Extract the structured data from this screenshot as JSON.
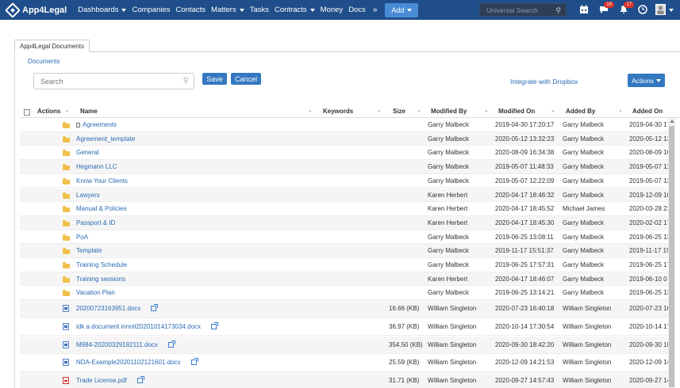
{
  "nav": {
    "brand": "App4Legal",
    "menu": [
      {
        "label": "Dashboards",
        "dropdown": true
      },
      {
        "label": "Companies",
        "dropdown": false
      },
      {
        "label": "Contacts",
        "dropdown": false
      },
      {
        "label": "Matters",
        "dropdown": true
      },
      {
        "label": "Tasks",
        "dropdown": false
      },
      {
        "label": "Contracts",
        "dropdown": true
      },
      {
        "label": "Money",
        "dropdown": false
      },
      {
        "label": "Docs",
        "dropdown": false
      }
    ],
    "more_icon": "double-chevron-down-icon",
    "add_label": "Add",
    "search_placeholder": "Universal Search",
    "messages_badge": "19",
    "notifications_badge": "17"
  },
  "tab": {
    "label": "App4Legal Documents"
  },
  "breadcrumb": "Documents",
  "search": {
    "placeholder": "Search"
  },
  "buttons": {
    "save": "Save",
    "cancel": "Cancel",
    "actions": "Actions"
  },
  "dropbox_link": "Integrate with Dropbox",
  "columns": {
    "actions": "Actions",
    "name": "Name",
    "keywords": "Keywords",
    "size": "Size",
    "modified_by": "Modified By",
    "modified_on": "Modified On",
    "added_by": "Added By",
    "added_on": "Added On"
  },
  "rows": [
    {
      "type": "folder",
      "name": "Agreements",
      "locked": true,
      "size": "",
      "modified_by": "Garry Malbeck",
      "modified_on": "2019-04-30 17:20:17",
      "added_by": "Garry Malbeck",
      "added_on": "2019-04-30 17"
    },
    {
      "type": "folder",
      "name": "Agreement_template",
      "locked": false,
      "size": "",
      "modified_by": "Garry Malbeck",
      "modified_on": "2020-05-12 13:32:23",
      "added_by": "Garry Malbeck",
      "added_on": "2020-05-12 13"
    },
    {
      "type": "folder",
      "name": "General",
      "locked": false,
      "size": "",
      "modified_by": "Garry Malbeck",
      "modified_on": "2020-08-09 16:34:38",
      "added_by": "Garry Malbeck",
      "added_on": "2020-08-09 16"
    },
    {
      "type": "folder",
      "name": "Hegmann LLC",
      "locked": false,
      "size": "",
      "modified_by": "Garry Malbeck",
      "modified_on": "2019-05-07 11:48:33",
      "added_by": "Garry Malbeck",
      "added_on": "2019-05-07 11"
    },
    {
      "type": "folder",
      "name": "Know Your Clients",
      "locked": false,
      "size": "",
      "modified_by": "Garry Malbeck",
      "modified_on": "2019-05-07 12:22:09",
      "added_by": "Garry Malbeck",
      "added_on": "2019-05-07 12"
    },
    {
      "type": "folder",
      "name": "Lawyers",
      "locked": false,
      "size": "",
      "modified_by": "Karen Herbert",
      "modified_on": "2020-04-17 18:46:32",
      "added_by": "Garry Malbeck",
      "added_on": "2019-12-09 16"
    },
    {
      "type": "folder",
      "name": "Manual & Policies",
      "locked": false,
      "size": "",
      "modified_by": "Karen Herbert",
      "modified_on": "2020-04-17 18:45:52",
      "added_by": "Michael James",
      "added_on": "2020-03-28 21"
    },
    {
      "type": "folder",
      "name": "Passport & ID",
      "locked": false,
      "size": "",
      "modified_by": "Karen Herbert",
      "modified_on": "2020-04-17 18:45:30",
      "added_by": "Garry Malbeck",
      "added_on": "2020-02-02 17"
    },
    {
      "type": "folder",
      "name": "PoA",
      "locked": false,
      "size": "",
      "modified_by": "Garry Malbeck",
      "modified_on": "2019-06-25 13:08:11",
      "added_by": "Garry Malbeck",
      "added_on": "2019-06-25 13"
    },
    {
      "type": "folder",
      "name": "Template",
      "locked": false,
      "size": "",
      "modified_by": "Garry Malbeck",
      "modified_on": "2019-11-17 15:51:37",
      "added_by": "Garry Malbeck",
      "added_on": "2019-11-17 15"
    },
    {
      "type": "folder",
      "name": "Training Schedule",
      "locked": false,
      "size": "",
      "modified_by": "Garry Malbeck",
      "modified_on": "2019-06-25 17:57:31",
      "added_by": "Garry Malbeck",
      "added_on": "2019-06-25 17"
    },
    {
      "type": "folder",
      "name": "Training sessions",
      "locked": false,
      "size": "",
      "modified_by": "Karen Herbert",
      "modified_on": "2020-04-17 18:46:07",
      "added_by": "Garry Malbeck",
      "added_on": "2019-06-10 0"
    },
    {
      "type": "folder",
      "name": "Vacation Plan",
      "locked": false,
      "size": "",
      "modified_by": "Garry Malbeck",
      "modified_on": "2019-06-25 13:14:21",
      "added_by": "Garry Malbeck",
      "added_on": "2019-06-25 13"
    },
    {
      "type": "docx",
      "name": "20200723163951.docx",
      "locked": false,
      "size": "16.66 (KB)",
      "modified_by": "William Singleton",
      "modified_on": "2020-07-23 16:40:18",
      "added_by": "William Singleton",
      "added_on": "2020-07-23 16"
    },
    {
      "type": "docx",
      "name": "idk a document innnit20201014173034.docx",
      "locked": false,
      "size": "36.97 (KB)",
      "modified_by": "William Singleton",
      "modified_on": "2020-10-14 17:30:54",
      "added_by": "William Singleton",
      "added_on": "2020-10-14 17"
    },
    {
      "type": "docx",
      "name": "M984-20200329182111.docx",
      "locked": false,
      "size": "354.50 (KB)",
      "modified_by": "William Singleton",
      "modified_on": "2020-09-30 18:42:20",
      "added_by": "William Singleton",
      "added_on": "2020-09-30 18"
    },
    {
      "type": "docx",
      "name": "NDA-Example20201102121601.docx",
      "locked": false,
      "size": "25.59 (KB)",
      "modified_by": "William Singleton",
      "modified_on": "2020-12-09 14:21:53",
      "added_by": "William Singleton",
      "added_on": "2020-12-09 14"
    },
    {
      "type": "pdf",
      "name": "Trade License.pdf",
      "locked": false,
      "size": "31.71 (KB)",
      "modified_by": "William Singleton",
      "modified_on": "2020-09-27 14:57:43",
      "added_by": "William Singleton",
      "added_on": "2020-09-27 14"
    }
  ]
}
